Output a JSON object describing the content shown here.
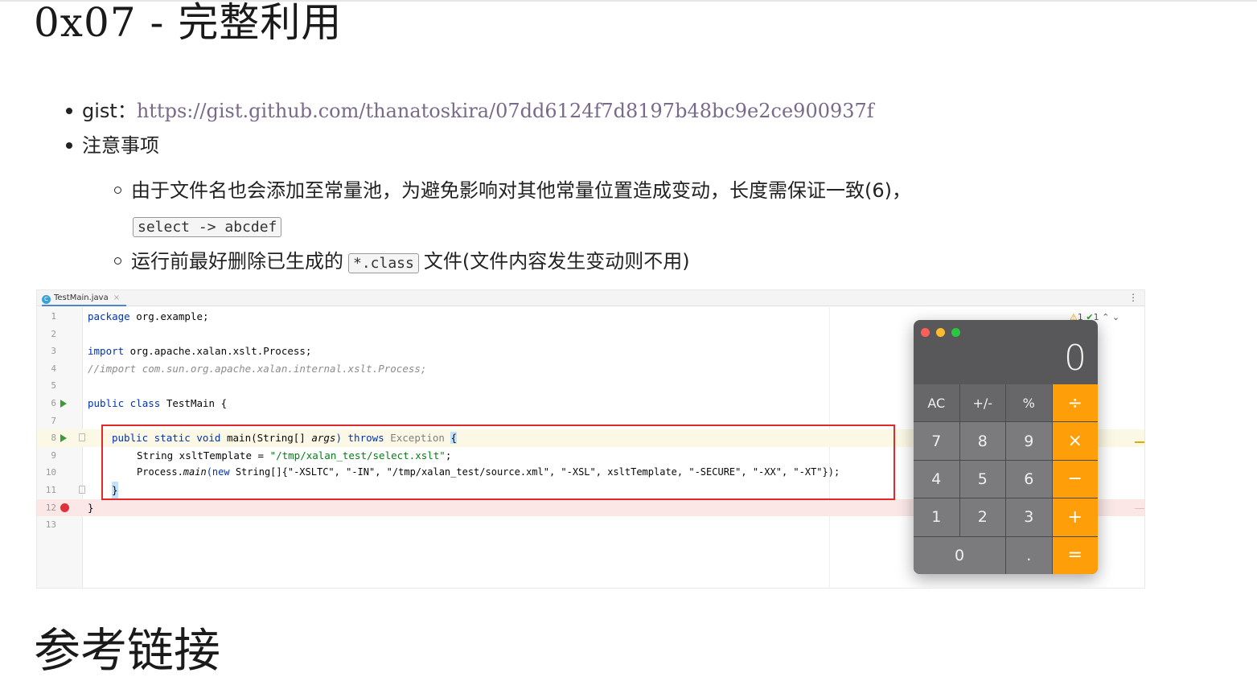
{
  "headings": {
    "exploit": "0x07 - 完整利用",
    "references": "参考链接"
  },
  "list": {
    "gist_label": "gist：",
    "gist_url": "https://gist.github.com/thanatoskira/07dd6124f7d8197b48bc9e2ce900937f",
    "notes_label": "注意事项",
    "sub1_text": "由于文件名也会添加至常量池，为避免影响对其他常量位置造成变动，长度需保证一致(6)，",
    "sub1_code": "select -> abcdef",
    "sub2_before": "运行前最好删除已生成的",
    "sub2_code": "*.class",
    "sub2_after": "文件(文件内容发生变动则不用)"
  },
  "ide": {
    "tab_name": "TestMain.java",
    "tab_close": "×",
    "menu_icon": "⋮",
    "inspection_warnings": "1",
    "inspection_ok": "1",
    "line_numbers": [
      "1",
      "2",
      "3",
      "4",
      "5",
      "6",
      "7",
      "8",
      "9",
      "10",
      "11",
      "12",
      "13"
    ],
    "code": {
      "l1_kw": "package",
      "l1_rest": " org.example;",
      "l3_kw": "import",
      "l3_rest": " org.apache.xalan.xslt.Process;",
      "l4": "//import com.sun.org.apache.xalan.internal.xslt.Process;",
      "l6_kw": "public class",
      "l6_rest": " TestMain {",
      "l8_kw1": "public static void",
      "l8_mid": " main(String[] ",
      "l8_args": "args",
      "l8_throws": ") throws",
      "l8_exc": " Exception",
      "l8_brace": "{",
      "l9_pre": "String xsltTemplate = ",
      "l9_str": "\"/tmp/xalan_test/select.xslt\"",
      "l9_end": ";",
      "l10_pre": "Process.",
      "l10_main": "main",
      "l10_new": "(new",
      "l10_args": " String[]{\"-XSLTC\", \"-IN\", \"/tmp/xalan_test/source.xml\", \"-XSL\", xsltTemplate, \"-SECURE\", \"-XX\", \"-XT\"});",
      "l11": "}",
      "l12": "}"
    }
  },
  "calculator": {
    "display": "0",
    "keys": [
      "AC",
      "+/-",
      "%",
      "÷",
      "7",
      "8",
      "9",
      "×",
      "4",
      "5",
      "6",
      "−",
      "1",
      "2",
      "3",
      "+",
      "0",
      ".",
      "="
    ]
  }
}
